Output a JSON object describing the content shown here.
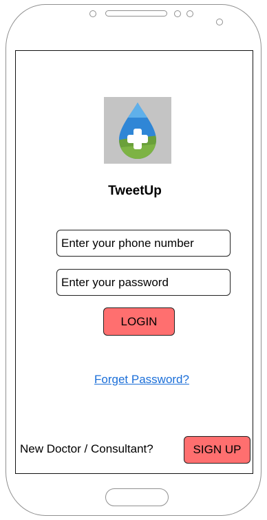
{
  "app": {
    "title": "TweetUp"
  },
  "login_form": {
    "phone_placeholder": "Enter your phone number",
    "password_placeholder": "Enter your password",
    "login_label": "LOGIN",
    "forgot_password_label": "Forget Password?"
  },
  "signup": {
    "prompt": "New Doctor / Consultant?",
    "button_label": "SIGN UP"
  },
  "icons": {
    "logo": "medical-drop-cross-logo"
  },
  "colors": {
    "button_fill": "#ff6f6f",
    "link": "#1a6ed8",
    "logo_blue": "#2f86d6",
    "logo_green": "#6aa03a"
  }
}
